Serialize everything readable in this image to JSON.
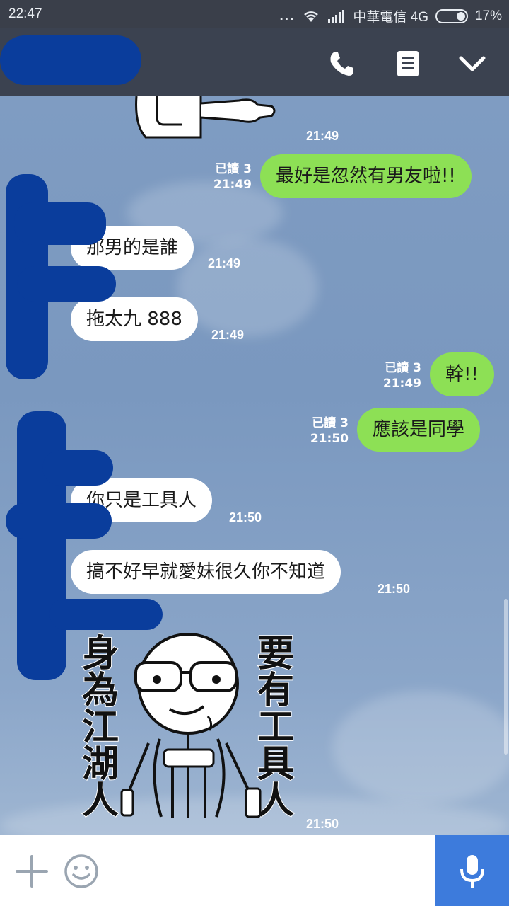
{
  "status_bar": {
    "time": "22:47",
    "dots": "...",
    "carrier": "中華電信 4G",
    "battery": "17%"
  },
  "top_bar": {
    "icons": [
      "phone-icon",
      "notes-icon",
      "chevron-down-icon"
    ]
  },
  "colors": {
    "outgoing_bubble": "#8de055",
    "incoming_bubble": "#ffffff",
    "chat_background": "#7f9cc3",
    "top_bar": "#3b4250",
    "mic_button": "#3d7bdc",
    "redaction": "#0a3d9c"
  },
  "messages": {
    "m0_time": "21:49",
    "m1": {
      "text": "最好是忽然有男友啦!!",
      "read": "已讀 3",
      "time": "21:49"
    },
    "m2": {
      "text": "那男的是誰",
      "time": "21:49"
    },
    "m3": {
      "text": "拖太九  888",
      "time": "21:49"
    },
    "m4": {
      "text": "幹!!",
      "read": "已讀 3",
      "time": "21:49"
    },
    "m5": {
      "text": "應該是同學",
      "read": "已讀 3",
      "time": "21:50"
    },
    "m6": {
      "text": "你只是工具人",
      "time": "21:50"
    },
    "m7": {
      "text": "搞不好早就愛妹很久你不知道",
      "time": "21:50"
    },
    "m8_time": "21:50"
  },
  "sticker": {
    "left_text": [
      "身",
      "為",
      "江",
      "湖",
      "人"
    ],
    "right_text": [
      "要",
      "有",
      "工",
      "具",
      "人"
    ]
  },
  "input_bar": {
    "icons": [
      "plus-icon",
      "emoji-icon",
      "microphone-icon"
    ]
  }
}
